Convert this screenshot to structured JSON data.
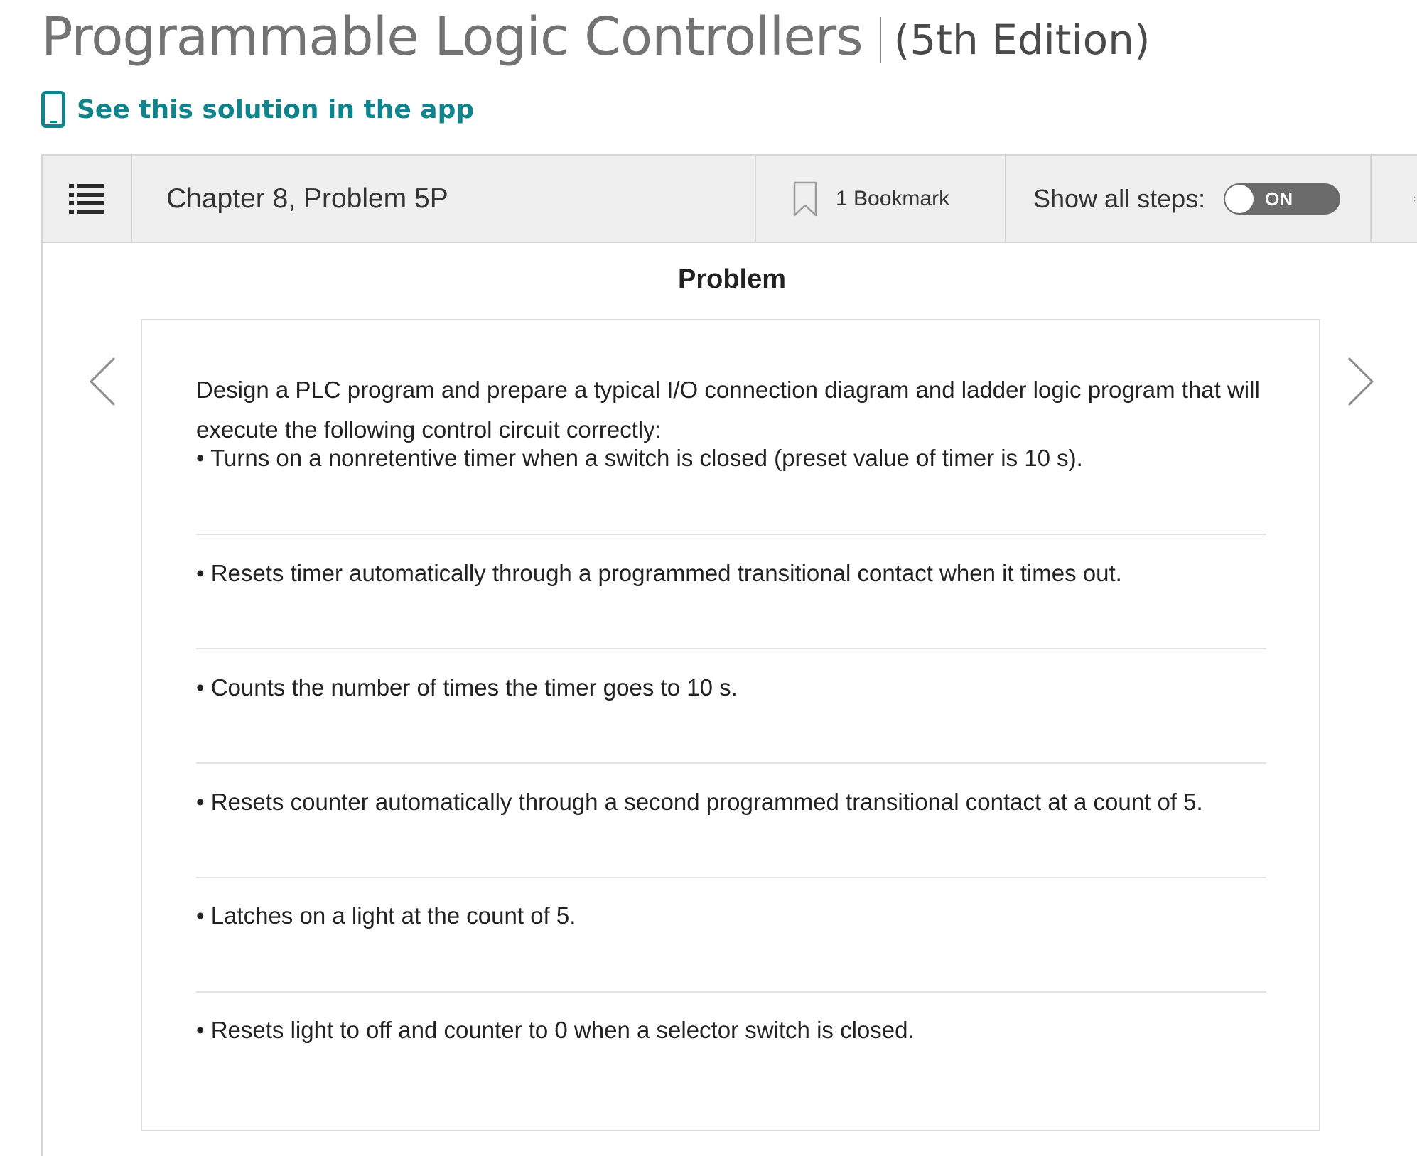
{
  "header": {
    "book_title": "Programmable Logic Controllers",
    "edition": "(5th Edition)"
  },
  "app_link": {
    "label": "See this solution in the app"
  },
  "toolbar": {
    "chapter_title": "Chapter 8, Problem 5P",
    "bookmark_label": "1 Bookmark",
    "show_steps_label": "Show all steps:",
    "toggle_label": "ON",
    "toggle_on": true
  },
  "problem": {
    "heading": "Problem",
    "intro": "Design a PLC program and prepare a typical I/O connection diagram and ladder logic program that will execute the following control circuit correctly:",
    "bullets": [
      "• Turns on a nonretentive timer when a switch is closed (preset value of timer is 10 s).",
      "• Resets timer automatically through a programmed transitional contact when it times out.",
      "• Counts the number of times the timer goes to 10 s.",
      "• Resets counter automatically through a second programmed transitional contact at a count of 5.",
      "• Latches on a light at the count of 5.",
      "• Resets light to off and counter to 0 when a selector switch is closed."
    ]
  },
  "colors": {
    "accent": "#10848c",
    "title_gray": "#737373",
    "toolbar_bg": "#efefef",
    "toggle_bg": "#6b6b6b"
  },
  "icons": {
    "menu": "list-icon",
    "app": "phone-icon",
    "bookmark": "bookmark-icon",
    "expand": "expand-icon",
    "prev": "chevron-left-icon",
    "next": "chevron-right-icon"
  }
}
